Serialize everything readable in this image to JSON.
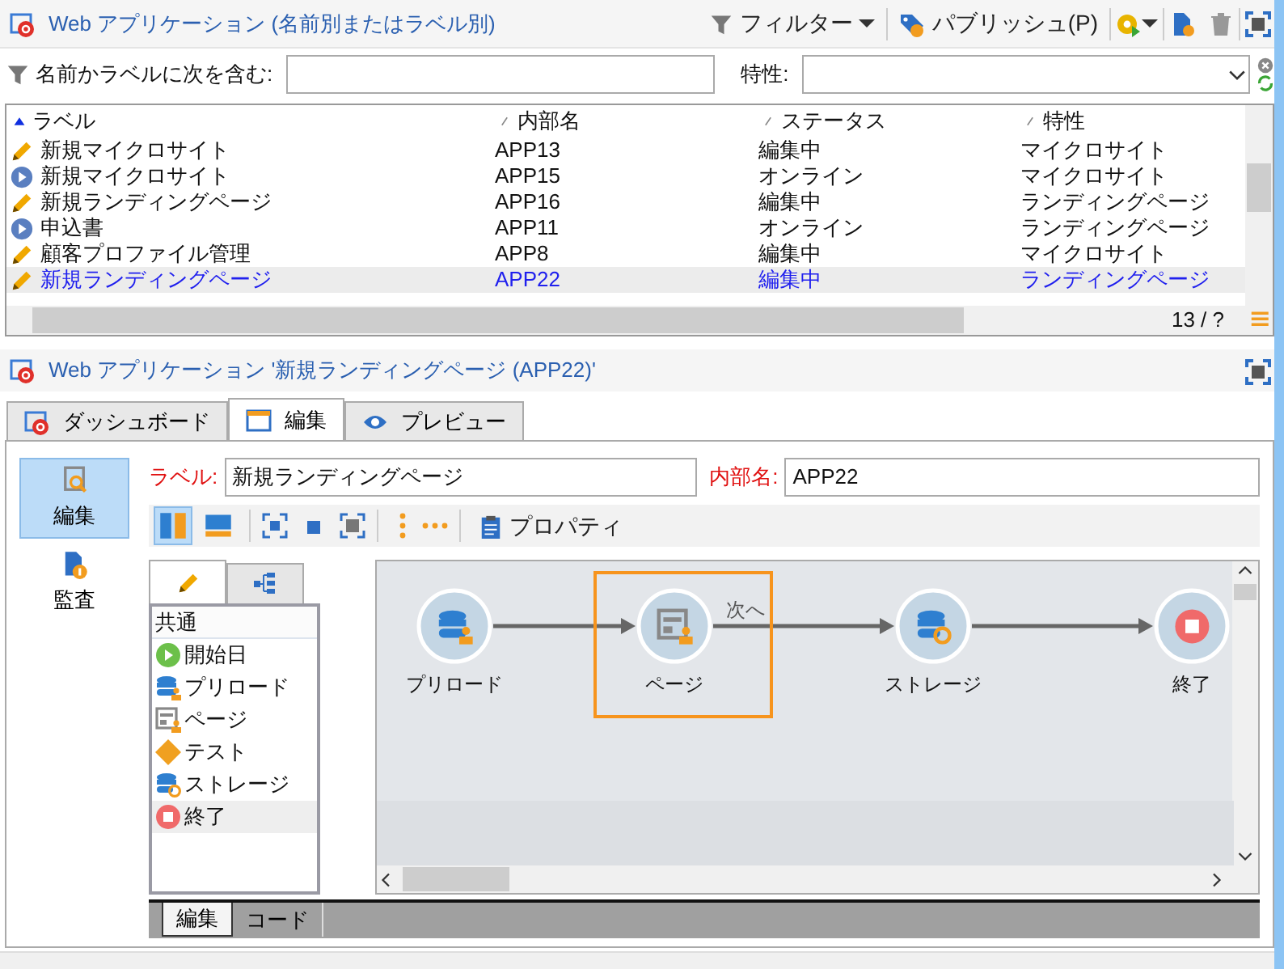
{
  "list_panel": {
    "title": "Web アプリケーション (名前別またはラベル別)",
    "filter_button": "フィルター",
    "publish_button": "パブリッシュ(P)"
  },
  "filter": {
    "name_label": "名前かラベルに次を含む:",
    "attribute_label": "特性:"
  },
  "table": {
    "columns": [
      {
        "label": "ラベル",
        "sorted": true
      },
      {
        "label": "内部名",
        "sorted": false
      },
      {
        "label": "ステータス",
        "sorted": false
      },
      {
        "label": "特性",
        "sorted": false
      }
    ],
    "rows": [
      {
        "kind": "editing",
        "label": "新規マイクロサイト",
        "internal_name": "APP13",
        "status": "編集中",
        "type": "マイクロサイト",
        "selected": false
      },
      {
        "kind": "online",
        "label": "新規マイクロサイト",
        "internal_name": "APP15",
        "status": "オンライン",
        "type": "マイクロサイト",
        "selected": false
      },
      {
        "kind": "editing",
        "label": "新規ランディングページ",
        "internal_name": "APP16",
        "status": "編集中",
        "type": "ランディングページ",
        "selected": false
      },
      {
        "kind": "online",
        "label": "申込書",
        "internal_name": "APP11",
        "status": "オンライン",
        "type": "ランディングページ",
        "selected": false
      },
      {
        "kind": "editing",
        "label": "顧客プロファイル管理",
        "internal_name": "APP8",
        "status": "編集中",
        "type": "マイクロサイト",
        "selected": false
      },
      {
        "kind": "editing",
        "label": "新規ランディングページ",
        "internal_name": "APP22",
        "status": "編集中",
        "type": "ランディングページ",
        "selected": true
      }
    ],
    "pager": "13 / ?"
  },
  "detail": {
    "title": "Web アプリケーション '新規ランディングページ (APP22)'",
    "tabs": [
      {
        "kind": "dashboard",
        "label": "ダッシュボード",
        "selected": false
      },
      {
        "kind": "edit",
        "label": "編集",
        "selected": true
      },
      {
        "kind": "preview",
        "label": "プレビュー",
        "selected": false
      }
    ],
    "side_items": [
      {
        "kind": "edit",
        "label": "編集",
        "selected": true
      },
      {
        "kind": "audit",
        "label": "監査",
        "selected": false
      }
    ],
    "label_field": {
      "label": "ラベル:",
      "value": "新規ランディングページ"
    },
    "internal_field": {
      "label": "内部名:",
      "value": "APP22"
    },
    "layout_buttons": [
      {
        "kind": "vertical",
        "selected": true
      },
      {
        "kind": "horizontal",
        "selected": false
      }
    ],
    "properties_button": "プロパティ",
    "palette": {
      "tabs": [
        {
          "kind": "activities",
          "selected": true
        },
        {
          "kind": "tree",
          "selected": false
        }
      ],
      "header": "共通",
      "items": [
        {
          "kind": "start",
          "label": "開始日",
          "selected": false
        },
        {
          "kind": "preload",
          "label": "プリロード",
          "selected": false
        },
        {
          "kind": "page",
          "label": "ページ",
          "selected": false
        },
        {
          "kind": "test",
          "label": "テスト",
          "selected": false
        },
        {
          "kind": "storage",
          "label": "ストレージ",
          "selected": false
        },
        {
          "kind": "end",
          "label": "終了",
          "selected": true
        }
      ]
    },
    "workflow": {
      "nodes": [
        {
          "kind": "preload",
          "label": "プリロード",
          "selected": false
        },
        {
          "kind": "page",
          "label": "ページ",
          "selected": true,
          "out_label": "次へ"
        },
        {
          "kind": "storage",
          "label": "ストレージ",
          "selected": false
        },
        {
          "kind": "end",
          "label": "終了",
          "selected": false
        }
      ]
    },
    "bottom_tabs": [
      {
        "label": "編集",
        "selected": true
      },
      {
        "label": "コード",
        "selected": false
      }
    ]
  }
}
